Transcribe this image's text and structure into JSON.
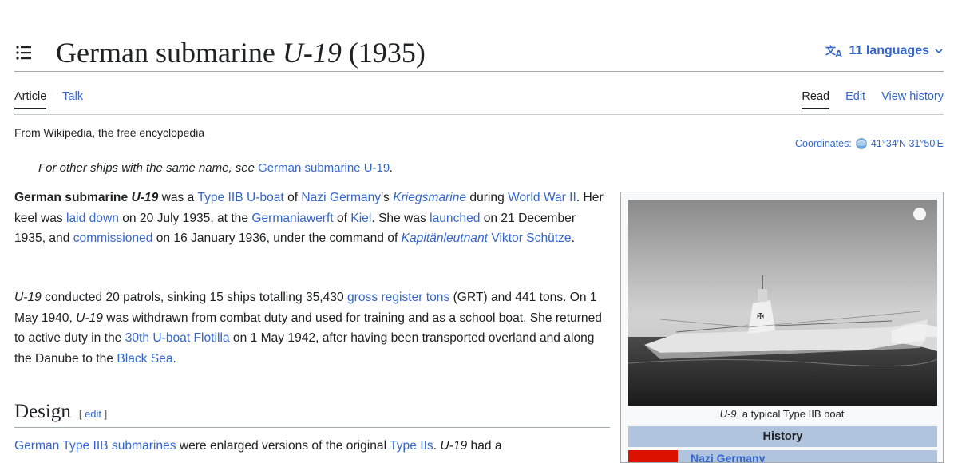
{
  "header": {
    "title_prefix": "German submarine ",
    "title_italic": "U-19",
    "title_suffix": " (1935)",
    "languages": "11 languages"
  },
  "tabs": {
    "left": [
      "Article",
      "Talk"
    ],
    "right": [
      "Read",
      "Edit",
      "View history"
    ]
  },
  "tagline": "From Wikipedia, the free encyclopedia",
  "coordinates": {
    "label": "Coordinates:",
    "value": "41°34′N 31°50′E"
  },
  "hatnote": {
    "text": "For other ships with the same name, see ",
    "link": "German submarine U-19",
    "end": "."
  },
  "p1": {
    "b1": "German submarine ",
    "b1i": "U-19",
    "t1": " was a ",
    "l1": "Type IIB U-boat",
    "t2": " of ",
    "l2": "Nazi Germany",
    "t3": "'s ",
    "l3": "Kriegsmarine",
    "t4": " during ",
    "l4": "World War II",
    "t5": ". Her keel was ",
    "l5": "laid down",
    "t6": " on 20 July 1935, at the ",
    "l6": "Germaniawerft",
    "t7": " of ",
    "l7": "Kiel",
    "t8": ". She was ",
    "l8": "launched",
    "t9": " on 21 December 1935, and ",
    "l9": "commissioned",
    "t10": " on 16 January 1936, under the command of ",
    "l10": "Kapitänleutnant",
    "t11": " ",
    "l11": "Viktor Schütze",
    "t12": "."
  },
  "p2": {
    "i1": "U-19",
    "t1": " conducted 20 patrols, sinking 15 ships totalling 35,430 ",
    "l1": "gross register tons",
    "t2": " (GRT) and 441 tons. On 1 May 1940, ",
    "i2": "U-19",
    "t3": " was withdrawn from combat duty and used for training and as a school boat. She returned to active duty in the ",
    "l2": "30th U-boat Flotilla",
    "t4": " on 1 May 1942, after having been transported overland and along the Danube to the ",
    "l3": "Black Sea",
    "t5": "."
  },
  "section": {
    "title": "Design",
    "edit_open": "[ ",
    "edit": "edit",
    "edit_close": " ]"
  },
  "p3": {
    "l1": "German Type IIB submarines",
    "t1": " were enlarged versions of the original ",
    "l2": "Type IIs",
    "t2": ". ",
    "i1": "U-19",
    "t3": " had a"
  },
  "infobox": {
    "caption_italic": "U-9",
    "caption_rest": ", a typical Type IIB boat",
    "history": "History",
    "flag_label": "Nazi Germany"
  },
  "colors": {
    "link": "#3366cc",
    "infobox_header": "#b0c4de",
    "text": "#202122"
  }
}
